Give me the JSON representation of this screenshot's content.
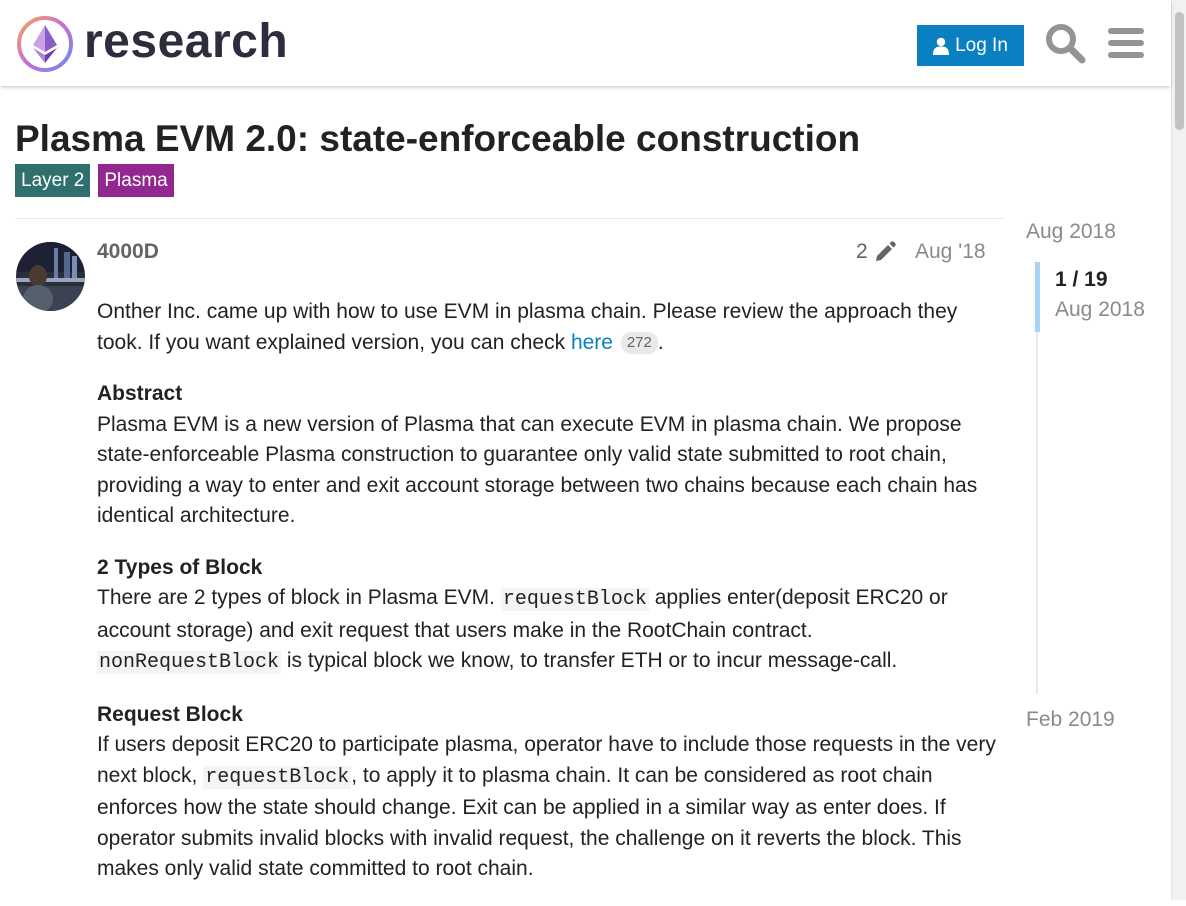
{
  "header": {
    "site_name": "research",
    "login_label": "Log In"
  },
  "topic": {
    "title": "Plasma EVM 2.0: state-enforceable construction",
    "tags": [
      {
        "label": "Layer 2",
        "color": "#2f6f6e"
      },
      {
        "label": "Plasma",
        "color": "#92278f"
      }
    ]
  },
  "post": {
    "username": "4000D",
    "edit_count": "2",
    "date": "Aug '18",
    "intro_1": "Onther Inc. came up with how to use EVM in plasma chain. Please review the approach they took. If you want explained version, you can check ",
    "intro_link": "here",
    "intro_link_clicks": "272",
    "intro_2": ".",
    "abstract_heading": "Abstract",
    "abstract_text": "Plasma EVM is a new version of Plasma that can execute EVM in plasma chain. We propose state-enforceable Plasma construction to guarantee only valid state submitted to root chain, providing a way to enter and exit account storage between two chains because each chain has identical architecture.",
    "types_heading": "2 Types of Block",
    "types_1": "There are 2 types of block in Plasma EVM. ",
    "types_code_1": "requestBlock",
    "types_2": " applies enter(deposit ERC20 or account storage) and exit request that users make in the RootChain contract. ",
    "types_code_2": "nonRequestBlock",
    "types_3": " is typical block we know, to transfer ETH or to incur message-call.",
    "request_heading": "Request Block",
    "request_1": "If users deposit ERC20 to participate plasma, operator have to include those requests in the very next block, ",
    "request_code": "requestBlock",
    "request_2": ", to apply it to plasma chain. It can be considered as root chain enforces how the state should change. Exit can be applied in a similar way as enter does. If operator submits invalid blocks with invalid request, the challenge on it reverts the block. This makes only valid state committed to root chain."
  },
  "timeline": {
    "start_date": "Aug 2018",
    "position": "1 / 19",
    "current_date": "Aug 2018",
    "end_date": "Feb 2019"
  },
  "icons": {
    "logo": "ethereum-logo-icon",
    "user": "user-icon",
    "search": "search-icon",
    "menu": "hamburger-menu-icon",
    "edit": "pencil-icon"
  },
  "colors": {
    "primary": "#0a7fc2",
    "timeline_handle": "#a9d3f3"
  }
}
